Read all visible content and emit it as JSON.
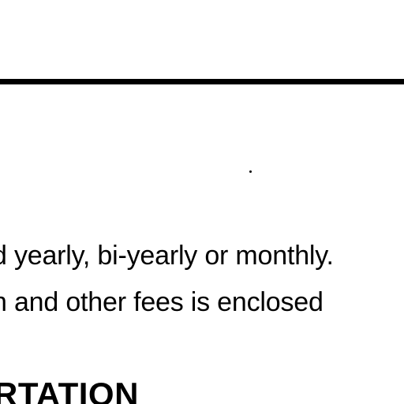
{
  "document": {
    "paragraph_lines": [
      "d yearly, bi-yearly or monthly.",
      "n and other fees is enclosed"
    ],
    "section_heading": "RTATION"
  }
}
